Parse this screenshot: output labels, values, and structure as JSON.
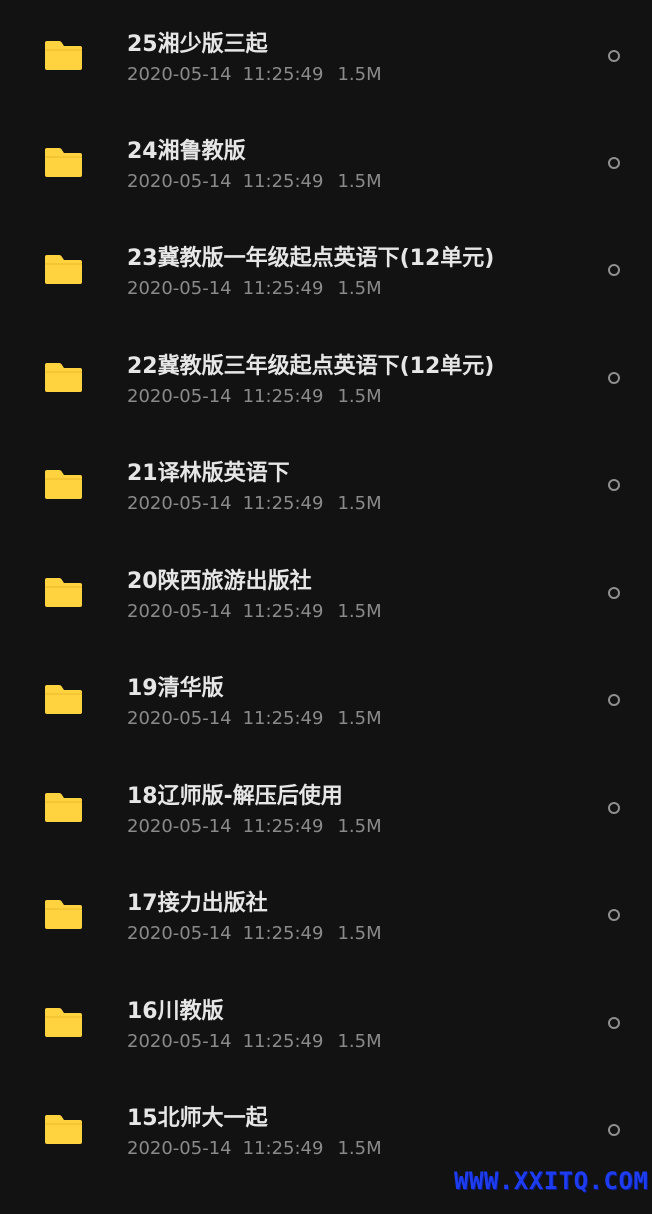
{
  "files": [
    {
      "name": "25湘少版三起",
      "date": "2020-05-14",
      "time": "11:25:49",
      "size": "1.5M"
    },
    {
      "name": "24湘鲁教版",
      "date": "2020-05-14",
      "time": "11:25:49",
      "size": "1.5M"
    },
    {
      "name": "23冀教版一年级起点英语下(12单元)",
      "date": "2020-05-14",
      "time": "11:25:49",
      "size": "1.5M"
    },
    {
      "name": "22冀教版三年级起点英语下(12单元)",
      "date": "2020-05-14",
      "time": "11:25:49",
      "size": "1.5M"
    },
    {
      "name": "21译林版英语下",
      "date": "2020-05-14",
      "time": "11:25:49",
      "size": "1.5M"
    },
    {
      "name": "20陕西旅游出版社",
      "date": "2020-05-14",
      "time": "11:25:49",
      "size": "1.5M"
    },
    {
      "name": "19清华版",
      "date": "2020-05-14",
      "time": "11:25:49",
      "size": "1.5M"
    },
    {
      "name": "18辽师版-解压后使用",
      "date": "2020-05-14",
      "time": "11:25:49",
      "size": "1.5M"
    },
    {
      "name": "17接力出版社",
      "date": "2020-05-14",
      "time": "11:25:49",
      "size": "1.5M"
    },
    {
      "name": "16川教版",
      "date": "2020-05-14",
      "time": "11:25:49",
      "size": "1.5M"
    },
    {
      "name": "15北师大一起",
      "date": "2020-05-14",
      "time": "11:25:49",
      "size": "1.5M"
    }
  ],
  "icon": "folder-icon",
  "colors": {
    "background": "#121212",
    "folder": "#ffd23f",
    "name_text": "#e6e6e6",
    "meta_text": "#8a8a8a",
    "radio": "#8f8f8f",
    "watermark": "#1e3df0"
  },
  "watermark": "WWW.XXITQ.COM"
}
